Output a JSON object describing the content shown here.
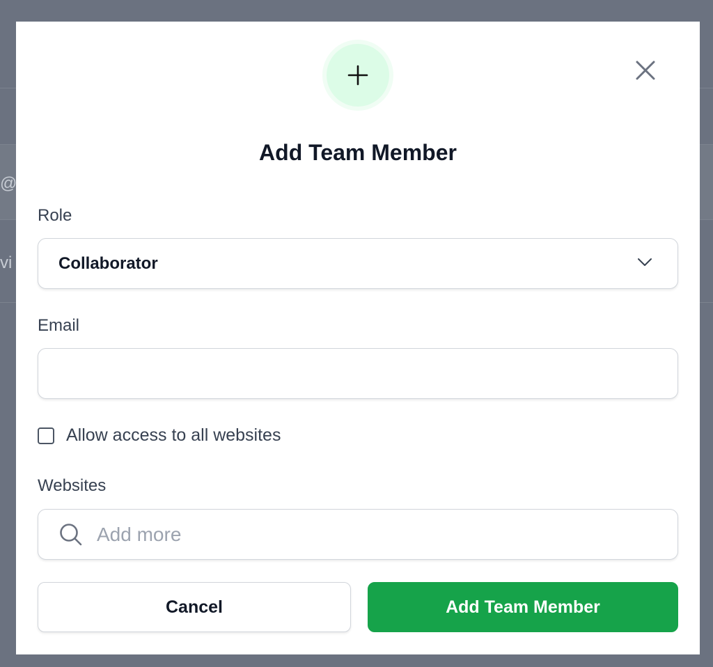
{
  "background": {
    "text_fragments": [
      "@i",
      "vi"
    ]
  },
  "modal": {
    "header_icon": "plus-icon",
    "close_icon": "close-icon",
    "title": "Add Team Member",
    "role": {
      "label": "Role",
      "selected": "Collaborator",
      "icon": "chevron-down-icon"
    },
    "email": {
      "label": "Email",
      "value": "",
      "placeholder": ""
    },
    "allow_all": {
      "label": "Allow access to all websites",
      "checked": false
    },
    "websites": {
      "label": "Websites",
      "placeholder": "Add more",
      "icon": "search-icon"
    },
    "buttons": {
      "cancel": "Cancel",
      "submit": "Add Team Member"
    }
  },
  "colors": {
    "overlay": "#6b7280",
    "accent_green": "#16a34a",
    "icon_circle": "#dcfce7",
    "title_text": "#111827"
  }
}
